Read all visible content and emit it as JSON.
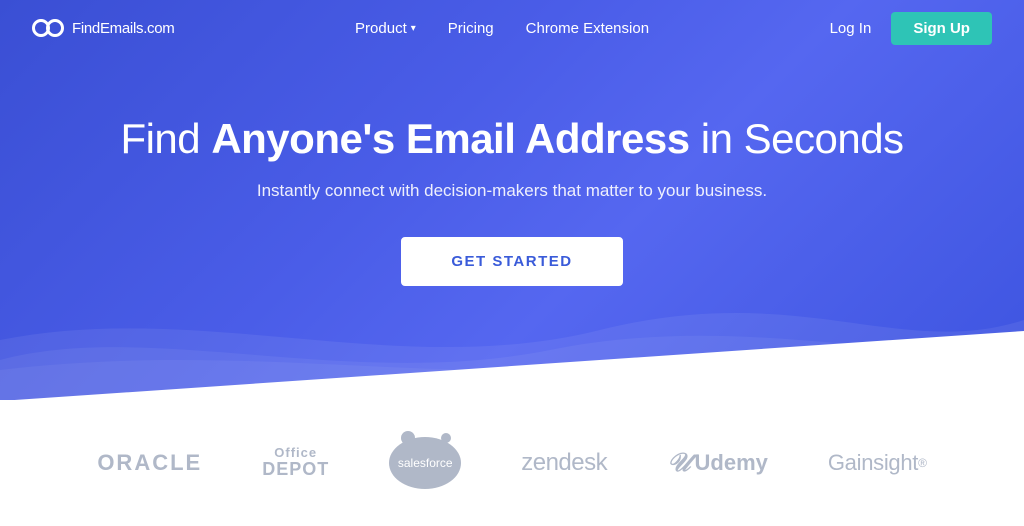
{
  "brand": {
    "name": "FindEmails",
    "tld": ".com"
  },
  "nav": {
    "links": [
      {
        "label": "Product",
        "hasDropdown": true
      },
      {
        "label": "Pricing",
        "hasDropdown": false
      },
      {
        "label": "Chrome Extension",
        "hasDropdown": false
      }
    ],
    "login_label": "Log In",
    "signup_label": "Sign Up"
  },
  "hero": {
    "title_plain_start": "Find ",
    "title_bold": "Anyone's Email Address",
    "title_plain_end": " in Seconds",
    "subtitle": "Instantly connect with decision-makers that matter to your business.",
    "cta_label": "GET STARTED"
  },
  "logos": [
    {
      "name": "oracle",
      "display": "ORACLE"
    },
    {
      "name": "office-depot",
      "display": "Office\nDEPOT"
    },
    {
      "name": "salesforce",
      "display": "salesforce"
    },
    {
      "name": "zendesk",
      "display": "zendesk"
    },
    {
      "name": "udemy",
      "display": "Udemy"
    },
    {
      "name": "gainsight",
      "display": "Gainsight"
    }
  ],
  "colors": {
    "hero_bg_start": "#3a4fd4",
    "hero_bg_end": "#5567f0",
    "signup_bg": "#2ec4b6",
    "cta_text": "#3a5bd9",
    "logo_color": "#b0b8c8"
  }
}
